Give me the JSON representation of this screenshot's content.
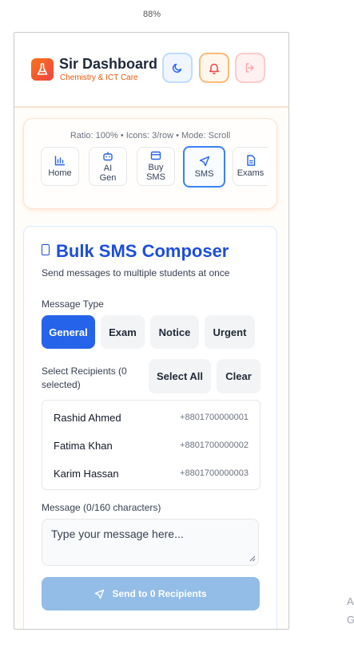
{
  "zoom_level": "88%",
  "side_letters": [
    "A",
    "G"
  ],
  "header": {
    "title": "Sir Dashboard",
    "subtitle": "Chemistry & ICT Care"
  },
  "nav": {
    "info": "Ratio: 100% • Icons: 3/row • Mode: Scroll",
    "items": [
      {
        "label": "Home",
        "icon": "chart-icon",
        "active": false
      },
      {
        "label": "AI\nGen",
        "icon": "robot-icon",
        "active": false
      },
      {
        "label": "Buy\nSMS",
        "icon": "card-icon",
        "active": false
      },
      {
        "label": "SMS",
        "icon": "send-icon",
        "active": true
      },
      {
        "label": "Exams",
        "icon": "document-icon",
        "active": false
      }
    ]
  },
  "composer": {
    "title": "Bulk SMS Composer",
    "subtitle": "Send messages to multiple students at once",
    "message_type_label": "Message Type",
    "message_types": [
      "General",
      "Exam",
      "Notice",
      "Urgent"
    ],
    "selected_type": "General",
    "recipients_label": "Select Recipients (0 selected)",
    "select_all_label": "Select All",
    "clear_label": "Clear",
    "recipients": [
      {
        "name": "Rashid Ahmed",
        "phone": "+8801700000001"
      },
      {
        "name": "Fatima Khan",
        "phone": "+8801700000002"
      },
      {
        "name": "Karim Hassan",
        "phone": "+8801700000003"
      }
    ],
    "message_label": "Message (0/160 characters)",
    "message_placeholder": "Type your message here...",
    "message_value": "",
    "send_label": "Send to 0 Recipients"
  },
  "colors": {
    "accent_blue": "#2563eb",
    "brand_orange": "#ea580c",
    "send_disabled": "#93bde6"
  }
}
